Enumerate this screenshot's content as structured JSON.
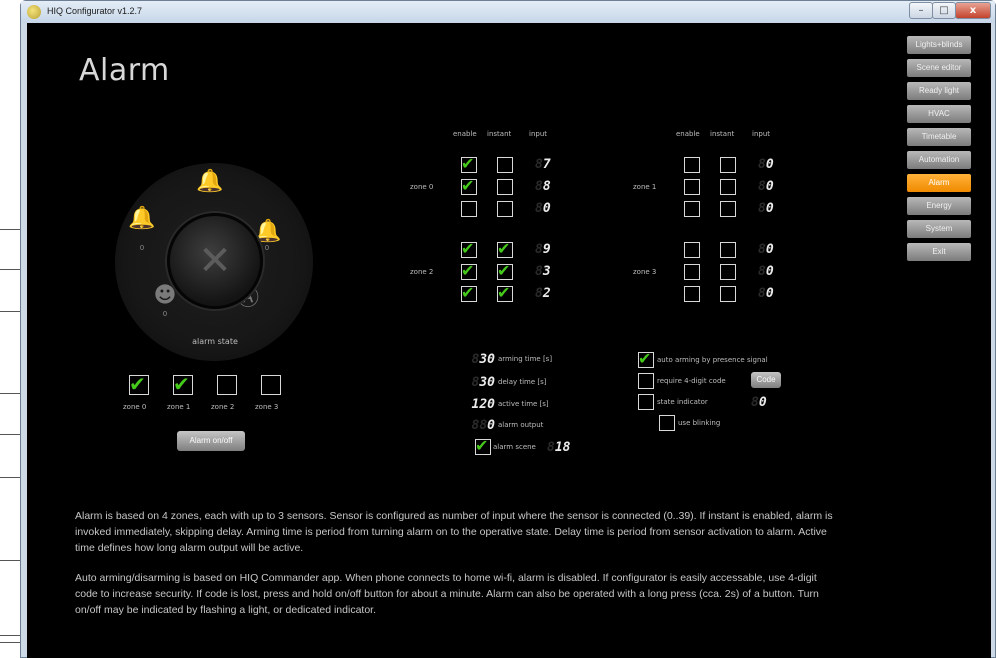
{
  "window": {
    "title": "HIQ Configurator v1.2.7",
    "controls": {
      "minimize": "–",
      "maximize": "□",
      "close": "x"
    }
  },
  "page": {
    "title": "Alarm"
  },
  "nav": {
    "items": [
      "Lights+blinds",
      "Scene editor",
      "Ready light",
      "HVAC",
      "Timetable",
      "Automation",
      "Alarm",
      "Energy",
      "System",
      "Exit"
    ],
    "active": "Alarm"
  },
  "dial": {
    "label": "alarm state",
    "center_symbol": "✕",
    "icon_names": [
      "bell-top-icon",
      "bell-left-icon",
      "bell-right-icon",
      "intruder-icon",
      "auto-arm-icon"
    ],
    "counters": {
      "left": "0",
      "right": "0",
      "intruder": "0"
    }
  },
  "zones": {
    "headers": {
      "enable": "enable",
      "instant": "instant",
      "input": "input"
    },
    "items": [
      {
        "label": "zone 0",
        "rows": [
          {
            "enable": true,
            "instant": false,
            "input": "7"
          },
          {
            "enable": true,
            "instant": false,
            "input": "8"
          },
          {
            "enable": false,
            "instant": false,
            "input": "0"
          }
        ]
      },
      {
        "label": "zone 1",
        "rows": [
          {
            "enable": false,
            "instant": false,
            "input": "0"
          },
          {
            "enable": false,
            "instant": false,
            "input": "0"
          },
          {
            "enable": false,
            "instant": false,
            "input": "0"
          }
        ]
      },
      {
        "label": "zone 2",
        "rows": [
          {
            "enable": true,
            "instant": true,
            "input": "9"
          },
          {
            "enable": true,
            "instant": true,
            "input": "3"
          },
          {
            "enable": true,
            "instant": true,
            "input": "2"
          }
        ]
      },
      {
        "label": "zone 3",
        "rows": [
          {
            "enable": false,
            "instant": false,
            "input": "0"
          },
          {
            "enable": false,
            "instant": false,
            "input": "0"
          },
          {
            "enable": false,
            "instant": false,
            "input": "0"
          }
        ]
      }
    ]
  },
  "zone_arm": {
    "items": [
      {
        "label": "zone 0",
        "checked": true
      },
      {
        "label": "zone 1",
        "checked": true
      },
      {
        "label": "zone 2",
        "checked": false
      },
      {
        "label": "zone 3",
        "checked": false
      }
    ],
    "button": "Alarm on/off"
  },
  "timing": {
    "arming_time": {
      "value": "30",
      "label": "arming time [s]"
    },
    "delay_time": {
      "value": "30",
      "label": "delay time [s]"
    },
    "active_time": {
      "value": "120",
      "label": "active time [s]"
    },
    "alarm_output": {
      "value": "0",
      "label": "alarm output"
    },
    "alarm_scene": {
      "checked": true,
      "label": "alarm scene",
      "value": "18"
    }
  },
  "options": {
    "auto_arming": {
      "checked": true,
      "label": "auto arming by presence signal"
    },
    "require_code": {
      "checked": false,
      "label": "require 4-digit code",
      "button": "Code"
    },
    "state_indicator": {
      "checked": false,
      "label": "state indicator",
      "value": "0"
    },
    "use_blinking": {
      "checked": false,
      "label": "use blinking"
    }
  },
  "description": {
    "p1": "Alarm is based on 4 zones, each with up to 3 sensors. Sensor is configured as number of input where the sensor is connected (0..39). If instant is enabled, alarm is invoked immediately, skipping delay. Arming time is period from turning alarm on to the operative state. Delay time is period from sensor activation to alarm. Active time defines how long alarm output will be active.",
    "p2": "Auto arming/disarming is based on HIQ Commander app. When phone connects to home wi-fi, alarm is disabled. If configurator is easily accessable, use 4-digit code to increase security. If code is lost, press and hold on/off button for about a minute. Alarm can also be operated with a long press (cca. 2s) of a button. Turn on/off may be indicated by flashing a light, or dedicated indicator."
  },
  "colors": {
    "accent": "#f79400",
    "check": "#45c91b",
    "background": "#000000",
    "titlebar": "#c6d6e8"
  }
}
